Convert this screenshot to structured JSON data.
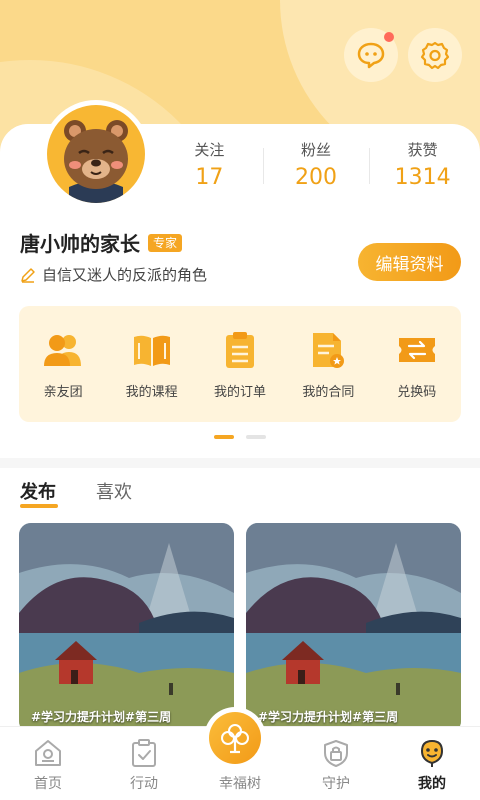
{
  "header": {
    "icons": [
      "chat-icon",
      "settings-icon"
    ],
    "has_notification": true
  },
  "profile": {
    "name": "唐小帅的家长",
    "badge": "专家",
    "bio": "自信又迷人的反派的角色",
    "edit_label": "编辑资料",
    "stats": [
      {
        "label": "关注",
        "value": "17"
      },
      {
        "label": "粉丝",
        "value": "200"
      },
      {
        "label": "获赞",
        "value": "1314"
      }
    ]
  },
  "menu": {
    "items": [
      {
        "label": "亲友团",
        "icon": "friends-icon"
      },
      {
        "label": "我的课程",
        "icon": "book-icon"
      },
      {
        "label": "我的订单",
        "icon": "order-icon"
      },
      {
        "label": "我的合同",
        "icon": "contract-icon"
      },
      {
        "label": "兑换码",
        "icon": "exchange-code-icon"
      }
    ],
    "page": 1,
    "pages": 2
  },
  "tabs": [
    {
      "label": "发布",
      "active": true
    },
    {
      "label": "喜欢",
      "active": false
    }
  ],
  "posts": [
    {
      "tag": "#学习力提升计划#第三周"
    },
    {
      "tag": "#学习力提升计划#第三周"
    }
  ],
  "nav": {
    "items": [
      {
        "label": "首页",
        "icon": "home-icon"
      },
      {
        "label": "行动",
        "icon": "action-icon"
      },
      {
        "label": "幸福树",
        "icon": "tree-icon"
      },
      {
        "label": "守护",
        "icon": "shield-icon"
      },
      {
        "label": "我的",
        "icon": "mine-icon",
        "active": true
      }
    ]
  },
  "colors": {
    "accent": "#f5a623",
    "header_bg": "#fbd98a",
    "menu_bg": "#fff4dc",
    "notification": "#ff6a5a"
  }
}
